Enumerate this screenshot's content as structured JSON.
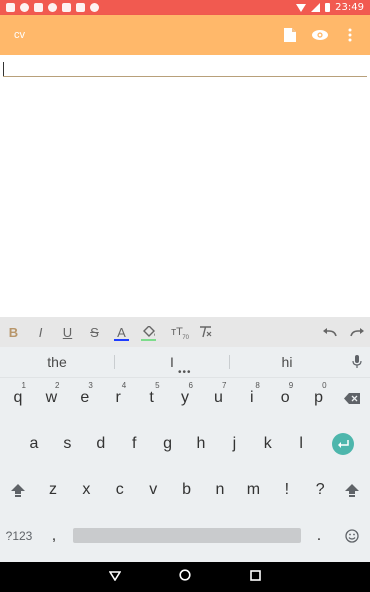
{
  "status_bar": {
    "time": "23:49",
    "color": "#f15a50",
    "left_icons": [
      "gmail-icon",
      "skype-icon",
      "gmail-icon",
      "notification-icon",
      "play-icon",
      "message-icon",
      "app-icon"
    ]
  },
  "app_bar": {
    "title": "cv",
    "color": "#ffb86a",
    "actions": [
      "file-icon",
      "eye-icon",
      "more-vert-icon"
    ]
  },
  "editor": {
    "value": ""
  },
  "format_toolbar": {
    "bold": "B",
    "italic": "I",
    "underline": "U",
    "strike": "S",
    "text_color": "A",
    "text_color_value": "#1e3cff",
    "highlight_color_value": "#7ddc8c",
    "text_size_label": "тT",
    "text_size_value": "70"
  },
  "keyboard": {
    "suggestions": [
      "the",
      "I",
      "hi"
    ],
    "row1": [
      {
        "k": "q",
        "h": "1"
      },
      {
        "k": "w",
        "h": "2"
      },
      {
        "k": "e",
        "h": "3"
      },
      {
        "k": "r",
        "h": "4"
      },
      {
        "k": "t",
        "h": "5"
      },
      {
        "k": "y",
        "h": "6"
      },
      {
        "k": "u",
        "h": "7"
      },
      {
        "k": "i",
        "h": "8"
      },
      {
        "k": "o",
        "h": "9"
      },
      {
        "k": "p",
        "h": "0"
      }
    ],
    "row2": [
      "a",
      "s",
      "d",
      "f",
      "g",
      "h",
      "j",
      "k",
      "l"
    ],
    "row3": [
      "z",
      "x",
      "c",
      "v",
      "b",
      "n",
      "m",
      "!",
      "?"
    ],
    "symbols_key": "?123",
    "comma_key": ",",
    "period_key": "."
  }
}
